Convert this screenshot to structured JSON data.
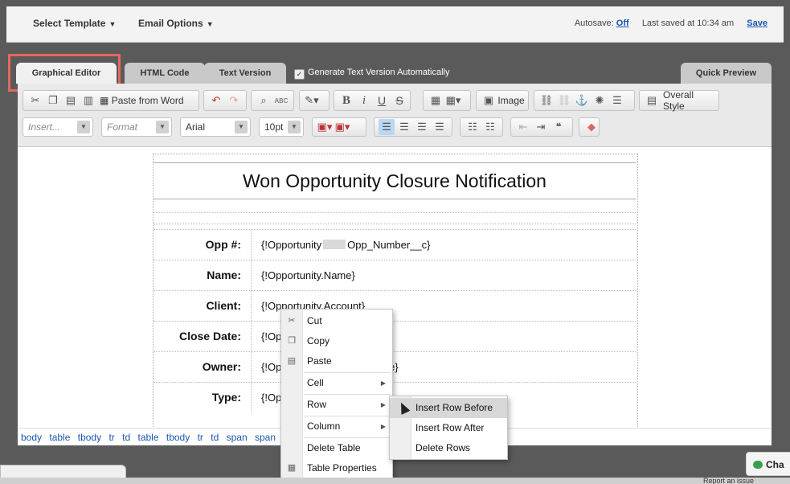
{
  "topbar": {
    "select_template": "Select Template",
    "email_options": "Email Options",
    "autosave_label": "Autosave:",
    "autosave_value": "Off",
    "last_saved": "Last saved at 10:34 am",
    "save": "Save"
  },
  "tabs": {
    "graphical_editor": "Graphical Editor",
    "html_code": "HTML Code",
    "text_version": "Text Version",
    "generate_text": "Generate Text Version Automatically",
    "quick_preview": "Quick Preview"
  },
  "toolbar": {
    "paste_from_word": "Paste from Word",
    "image": "Image",
    "overall_style": "Overall Style",
    "insert_placeholder": "Insert...",
    "format_placeholder": "Format",
    "font": "Arial",
    "size": "10pt",
    "bold": "B",
    "italic": "i",
    "underline": "U",
    "strike": "S"
  },
  "document": {
    "title": "Won Opportunity Closure Notification",
    "rows": [
      {
        "label": "Opp #:",
        "value_pre": "{!Opportunity",
        "value_post": "Opp_Number__c}"
      },
      {
        "label": "Name:",
        "value": "{!Opportunity.Name}"
      },
      {
        "label": "Client:",
        "value": "{!Opportunity.Account}"
      },
      {
        "label": "Close Date:",
        "value": "{!Op"
      },
      {
        "label": "Owner:",
        "value_pre": "{!Op",
        "value_post": "me}"
      },
      {
        "label": "Type:",
        "value": "{!Op"
      }
    ]
  },
  "pathbar": [
    "body",
    "table",
    "tbody",
    "tr",
    "td",
    "table",
    "tbody",
    "tr",
    "td",
    "span",
    "span"
  ],
  "context_menu": {
    "cut": "Cut",
    "copy": "Copy",
    "paste": "Paste",
    "cell": "Cell",
    "row": "Row",
    "column": "Column",
    "delete_table": "Delete Table",
    "table_properties": "Table Properties"
  },
  "row_submenu": {
    "insert_before": "Insert Row Before",
    "insert_after": "Insert Row After",
    "delete_rows": "Delete Rows"
  },
  "chat": "Cha",
  "report_issue": "Report an issue"
}
